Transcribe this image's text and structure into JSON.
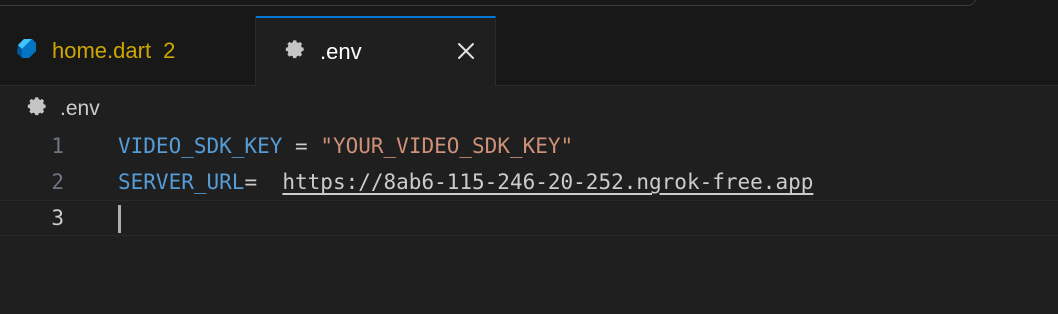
{
  "tabs": [
    {
      "label": "home.dart",
      "problems": "2",
      "icon": "dart-icon",
      "active": false
    },
    {
      "label": ".env",
      "icon": "gear-icon",
      "active": true,
      "close_icon": "close-icon"
    }
  ],
  "breadcrumb": {
    "label": ".env",
    "icon": "gear-icon"
  },
  "editor": {
    "lines": [
      {
        "number": "1",
        "key": "VIDEO_SDK_KEY",
        "op": " = ",
        "value": "\"YOUR_VIDEO_SDK_KEY\""
      },
      {
        "number": "2",
        "key": "SERVER_URL",
        "op": "=  ",
        "value": "https://8ab6-115-246-20-252.ngrok-free.app"
      },
      {
        "number": "3",
        "key": "",
        "op": "",
        "value": ""
      }
    ]
  },
  "colors": {
    "accent": "#0078d4",
    "warning": "#cca700",
    "key": "#569cd6",
    "string": "#ce9178",
    "background": "#1f1f1f"
  }
}
